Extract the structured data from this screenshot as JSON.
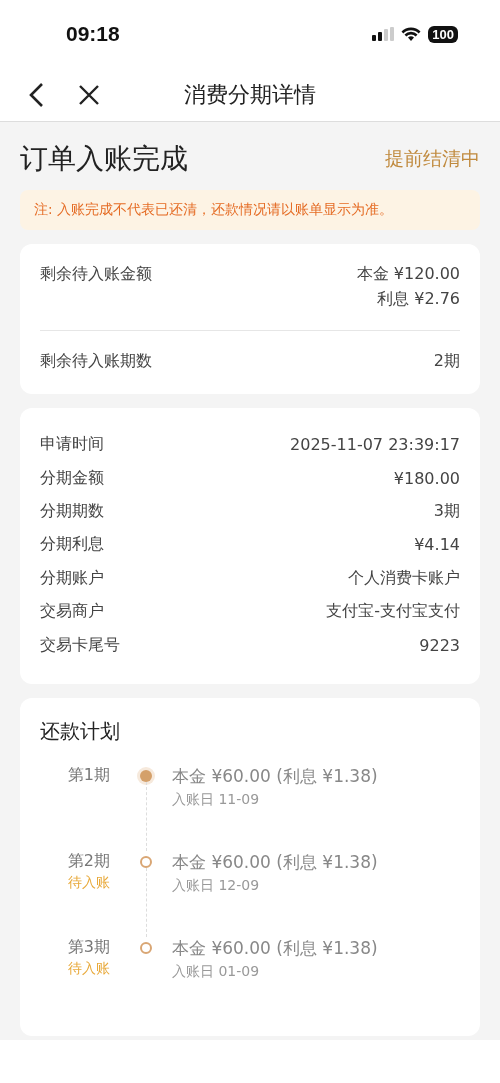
{
  "status_bar": {
    "time": "09:18",
    "battery": "100"
  },
  "nav": {
    "title": "消费分期详情"
  },
  "header": {
    "title": "订单入账完成",
    "status": "提前结清中"
  },
  "notice": "注: 入账完成不代表已还清，还款情况请以账单显示为准。",
  "remaining": {
    "amount_label": "剩余待入账金额",
    "principal": "本金 ¥120.00",
    "interest": "利息 ¥2.76",
    "periods_label": "剩余待入账期数",
    "periods": "2期"
  },
  "details": [
    {
      "label": "申请时间",
      "value": "2025-11-07 23:39:17"
    },
    {
      "label": "分期金额",
      "value": "¥180.00"
    },
    {
      "label": "分期期数",
      "value": "3期"
    },
    {
      "label": "分期利息",
      "value": "¥4.14"
    },
    {
      "label": "分期账户",
      "value": "个人消费卡账户"
    },
    {
      "label": "交易商户",
      "value": "支付宝-支付宝支付"
    },
    {
      "label": "交易卡尾号",
      "value": "9223"
    }
  ],
  "plan": {
    "title": "还款计划",
    "items": [
      {
        "period": "第1期",
        "settled": true,
        "amount": "本金 ¥60.00 (利息 ¥1.38)",
        "date": "入账日 11-09"
      },
      {
        "period": "第2期",
        "settled": false,
        "status": "待入账",
        "amount": "本金 ¥60.00 (利息 ¥1.38)",
        "date": "入账日 12-09"
      },
      {
        "period": "第3期",
        "settled": false,
        "status": "待入账",
        "amount": "本金 ¥60.00 (利息 ¥1.38)",
        "date": "入账日 01-09"
      }
    ]
  }
}
